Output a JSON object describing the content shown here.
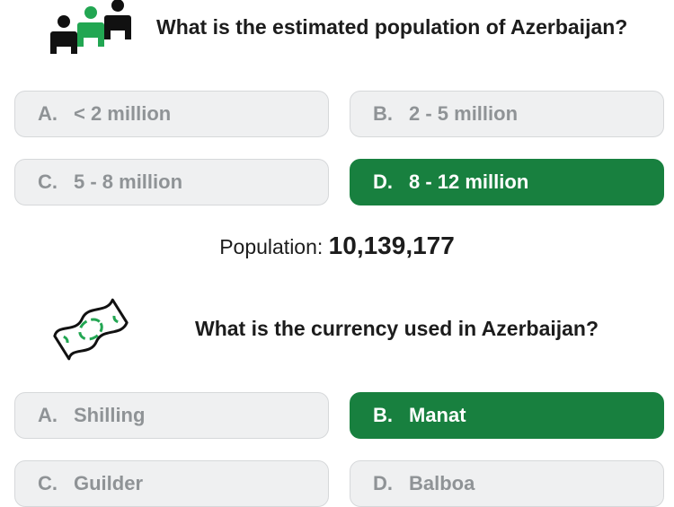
{
  "quiz": [
    {
      "icon": "people-icon",
      "question": "What is the estimated population of Azerbaijan?",
      "options": [
        {
          "letter": "A.",
          "text": "< 2 million"
        },
        {
          "letter": "B.",
          "text": "2 - 5 million"
        },
        {
          "letter": "C.",
          "text": "5 - 8 million"
        },
        {
          "letter": "D.",
          "text": "8 - 12 million",
          "correct": true
        }
      ],
      "answer_label": "Population:",
      "answer_value": "10,139,177"
    },
    {
      "icon": "banknote-icon",
      "question": "What is the currency used in Azerbaijan?",
      "options": [
        {
          "letter": "A.",
          "text": "Shilling"
        },
        {
          "letter": "B.",
          "text": "Manat",
          "correct": true
        },
        {
          "letter": "C.",
          "text": "Guilder"
        },
        {
          "letter": "D.",
          "text": "Balboa"
        }
      ]
    }
  ],
  "colors": {
    "correct": "#18803f",
    "option_bg": "#eff0f1",
    "option_text": "#8f9396",
    "accent_icon": "#22a652"
  }
}
